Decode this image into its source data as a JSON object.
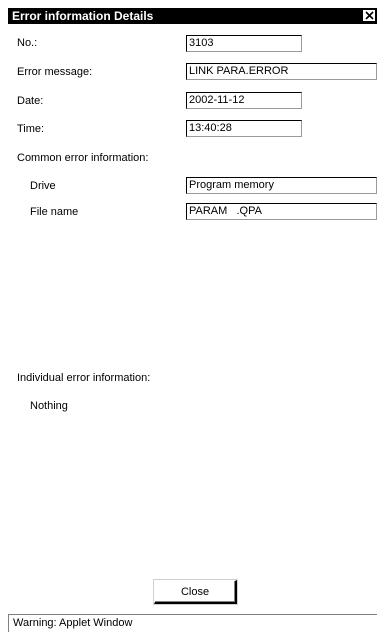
{
  "window": {
    "title": "Error information Details"
  },
  "fields": {
    "no_label": "No.:",
    "no_value": "3103",
    "message_label": "Error message:",
    "message_value": "LINK PARA.ERROR",
    "date_label": "Date:",
    "date_value": "2002-11-12",
    "time_label": "Time:",
    "time_value": "13:40:28"
  },
  "common": {
    "heading": "Common error information:",
    "drive_label": "Drive",
    "drive_value": "Program memory",
    "file_label": "File name",
    "file_value": "PARAM   .QPA"
  },
  "individual": {
    "heading": "Individual error information:",
    "value": "Nothing"
  },
  "buttons": {
    "close_label": "Close"
  },
  "status": {
    "text": "Warning: Applet Window"
  },
  "icons": {
    "close": "close-icon"
  }
}
